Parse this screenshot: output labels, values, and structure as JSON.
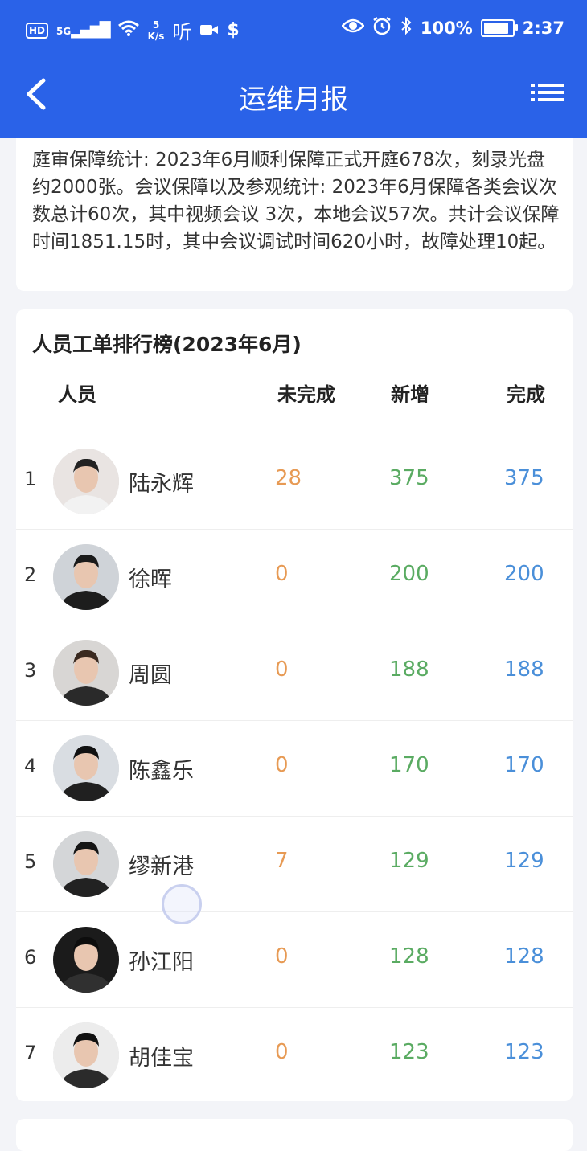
{
  "status_bar": {
    "hd": "HD",
    "network": "5G",
    "speed_value": "5",
    "speed_unit": "K/s",
    "battery_text": "100%",
    "battery_level": 1.0,
    "time": "2:37"
  },
  "nav": {
    "title": "运维月报",
    "back_icon": "chevron-left-icon",
    "menu_icon": "list-menu-icon"
  },
  "summary": {
    "text": "庭审保障统计: 2023年6月顺利保障正式开庭678次，刻录光盘约2000张。会议保障以及参观统计: 2023年6月保障各类会议次数总计60次，其中视频会议 3次，本地会议57次。共计会议保障时间1851.15时，其中会议调试时间620小时，故障处理10起。"
  },
  "ranking": {
    "title": "人员工单排行榜(2023年6月)",
    "headers": {
      "person": "人员",
      "unfinished": "未完成",
      "new": "新增",
      "done": "完成"
    },
    "rows": [
      {
        "rank": "1",
        "name": "陆永辉",
        "unfinished": "28",
        "new": "375",
        "done": "375"
      },
      {
        "rank": "2",
        "name": "徐晖",
        "unfinished": "0",
        "new": "200",
        "done": "200"
      },
      {
        "rank": "3",
        "name": "周圆",
        "unfinished": "0",
        "new": "188",
        "done": "188"
      },
      {
        "rank": "4",
        "name": "陈鑫乐",
        "unfinished": "0",
        "new": "170",
        "done": "170"
      },
      {
        "rank": "5",
        "name": "缪新港",
        "unfinished": "7",
        "new": "129",
        "done": "129"
      },
      {
        "rank": "6",
        "name": "孙江阳",
        "unfinished": "0",
        "new": "128",
        "done": "128"
      },
      {
        "rank": "7",
        "name": "胡佳宝",
        "unfinished": "0",
        "new": "123",
        "done": "123"
      }
    ]
  },
  "colors": {
    "brand": "#2a62e8",
    "unfinished": "#e79a54",
    "new": "#5aab62",
    "done": "#4a8fd9"
  }
}
